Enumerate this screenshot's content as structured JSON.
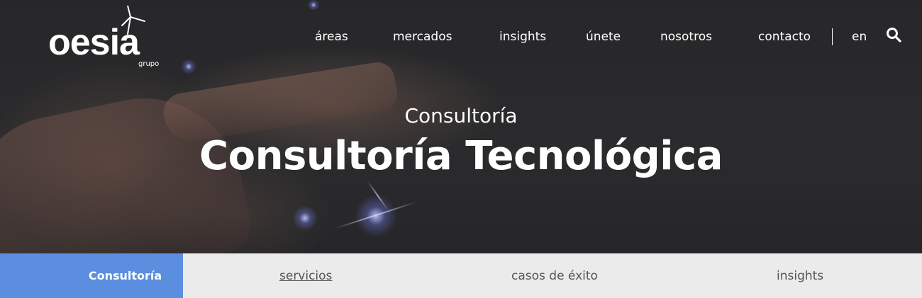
{
  "brand": {
    "name": "oesia",
    "sub": "grupo"
  },
  "nav": {
    "items": [
      "áreas",
      "mercados",
      "insights",
      "únete",
      "nosotros",
      "contacto"
    ],
    "language": "en",
    "search_icon": "search-icon"
  },
  "hero": {
    "kicker": "Consultoría",
    "title": "Consultoría Tecnológica"
  },
  "subnav": {
    "active": "Consultoría",
    "links": [
      "servicios",
      "casos de éxito",
      "insights"
    ]
  },
  "colors": {
    "accent": "#5b8ede",
    "subnav_bg": "#ebebeb",
    "hero_bg": "#2a2a2c",
    "text_light": "#ffffff",
    "text_dark": "#555555"
  }
}
